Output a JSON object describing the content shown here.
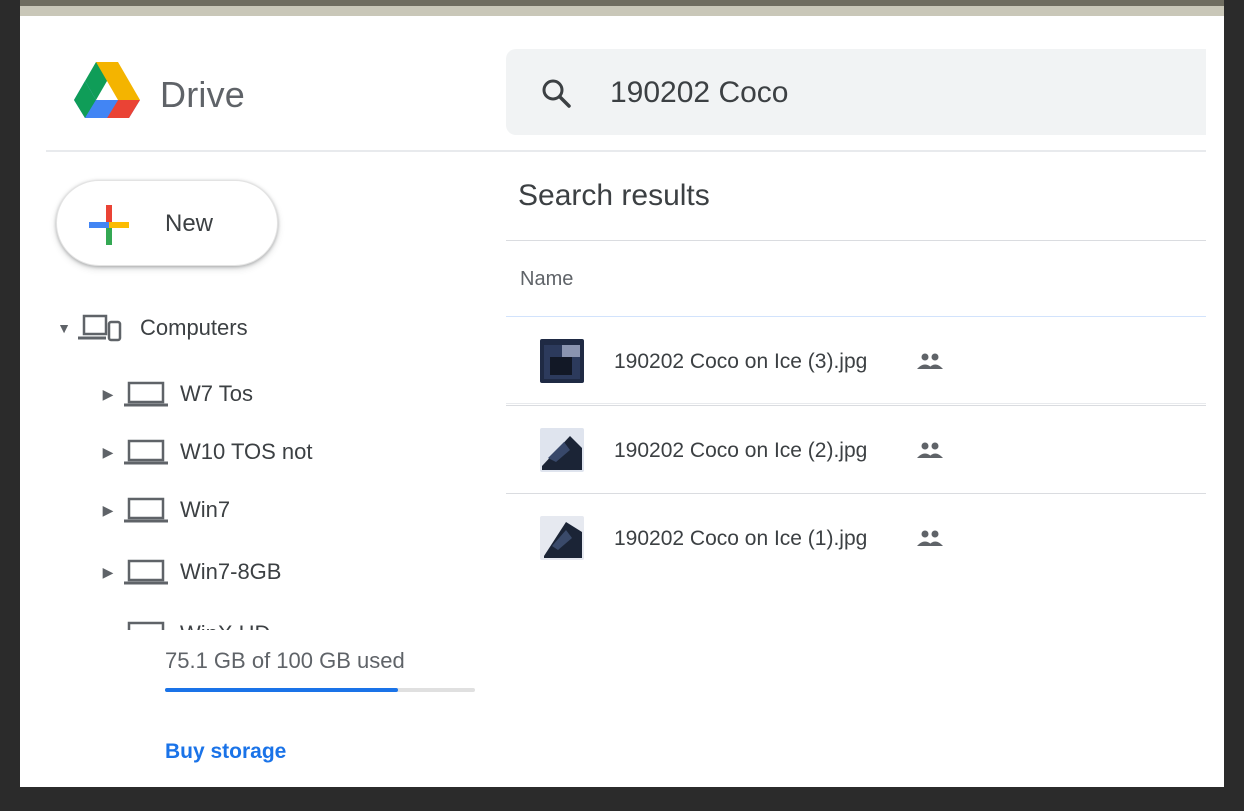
{
  "app": {
    "name": "Drive"
  },
  "search": {
    "query": "190202 Coco"
  },
  "new_button": {
    "label": "New"
  },
  "sidebar": {
    "root": {
      "label": "Computers"
    },
    "computers": [
      {
        "label": "W7 Tos"
      },
      {
        "label": "W10 TOS not"
      },
      {
        "label": "Win7"
      },
      {
        "label": "Win7-8GB"
      },
      {
        "label": "WinX HD"
      }
    ]
  },
  "storage": {
    "usage_text": "75.1 GB of 100 GB used",
    "used_fraction": 0.751,
    "buy_label": "Buy storage"
  },
  "results": {
    "title": "Search results",
    "column_name": "Name",
    "files": [
      {
        "name": "190202 Coco on Ice (3).jpg",
        "shared": true
      },
      {
        "name": "190202 Coco on Ice (2).jpg",
        "shared": true
      },
      {
        "name": "190202 Coco on Ice (1).jpg",
        "shared": true
      }
    ]
  },
  "colors": {
    "accent": "#1a73e8",
    "text": "#3c4043",
    "muted": "#5f6368",
    "search_bg": "#f1f3f4"
  }
}
